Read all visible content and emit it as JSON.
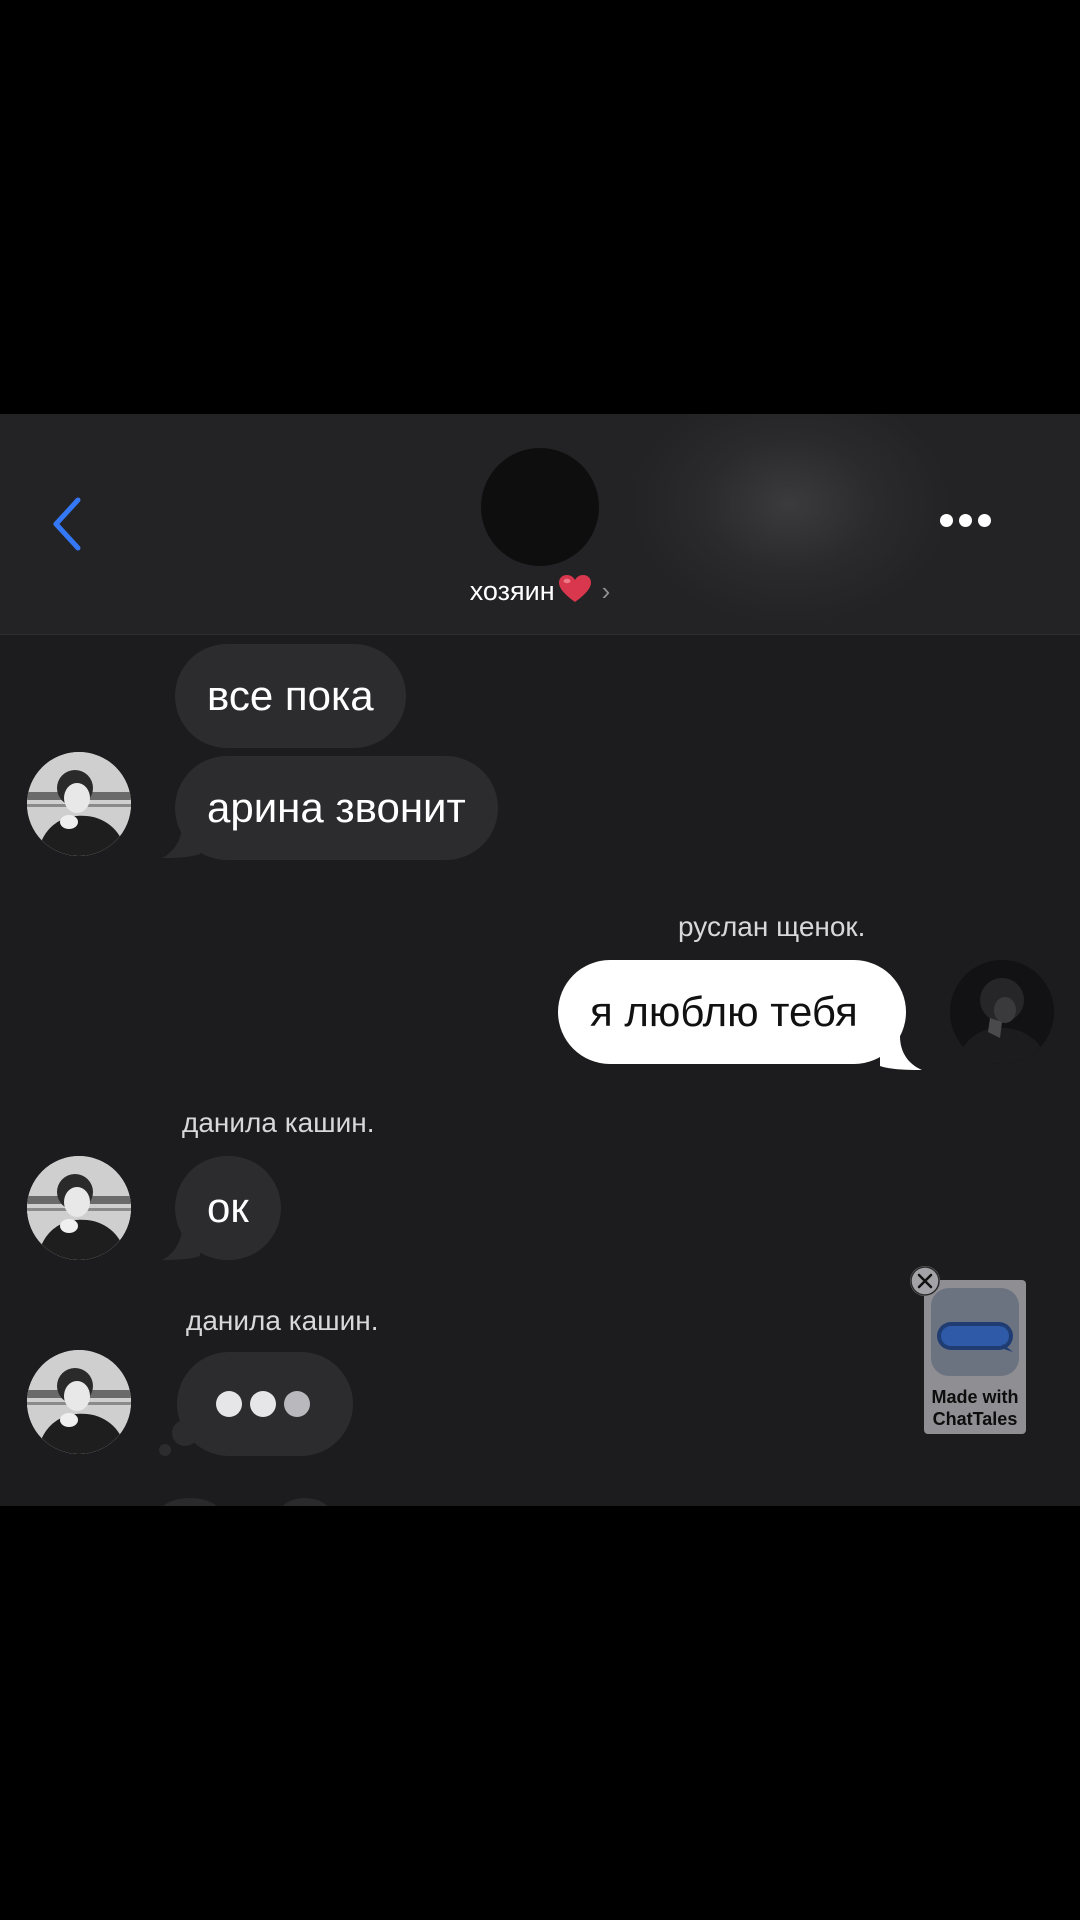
{
  "header": {
    "contact_name": "хозяин",
    "chevron": "›",
    "back_icon": "chevron-left-icon",
    "more_icon": "ellipsis-icon",
    "accent_color": "#3478f6"
  },
  "messages": [
    {
      "direction": "incoming",
      "sender": "",
      "text": "все пока"
    },
    {
      "direction": "incoming",
      "sender": "",
      "text": "арина звонит"
    },
    {
      "direction": "outgoing",
      "sender": "руслан щенок.",
      "text": "я люблю тебя"
    },
    {
      "direction": "incoming",
      "sender": "данила кашин.",
      "text": "ок"
    },
    {
      "direction": "incoming",
      "sender": "данила кашин.",
      "typing": true
    }
  ],
  "watermark": {
    "line1": "Made with",
    "line2": "ChatTales",
    "close_icon": "close-icon"
  },
  "colors": {
    "background": "#1c1c1e",
    "incoming_bubble": "#2c2c2e",
    "outgoing_bubble": "#ffffff"
  }
}
